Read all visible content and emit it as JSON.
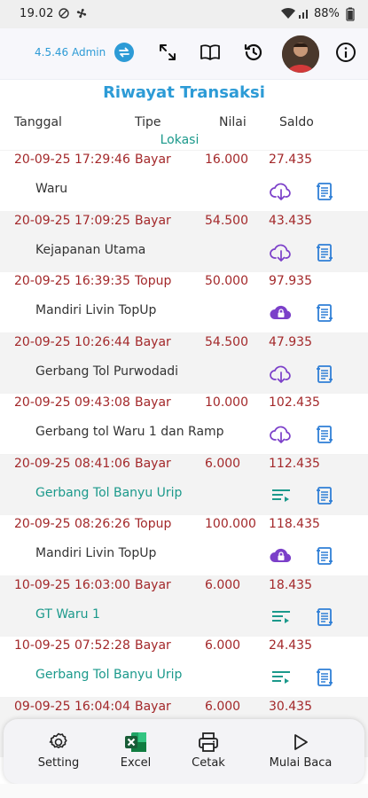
{
  "status_bar": {
    "time": "19.02",
    "battery": "88%"
  },
  "toolbar": {
    "version": "4.5.46 Admin"
  },
  "page": {
    "title": "Riwayat Transaksi",
    "columns": {
      "date": "Tanggal",
      "type": "Tipe",
      "value": "Nilai",
      "balance": "Saldo",
      "location": "Lokasi"
    }
  },
  "transactions": [
    {
      "date": "20-09-25 17:29:46",
      "type": "Bayar",
      "value": "16.000",
      "balance": "27.435",
      "location": "Waru",
      "loc_teal": false,
      "action_icon": "cloud-download-icon"
    },
    {
      "date": "20-09-25 17:09:25",
      "type": "Bayar",
      "value": "54.500",
      "balance": "43.435",
      "location": "Kejapanan Utama",
      "loc_teal": false,
      "action_icon": "cloud-download-icon"
    },
    {
      "date": "20-09-25 16:39:35",
      "type": "Topup",
      "value": "50.000",
      "balance": "97.935",
      "location": "Mandiri Livin TopUp",
      "loc_teal": false,
      "action_icon": "cloud-lock-icon"
    },
    {
      "date": "20-09-25 10:26:44",
      "type": "Bayar",
      "value": "54.500",
      "balance": "47.935",
      "location": "Gerbang Tol Purwodadi",
      "loc_teal": false,
      "action_icon": "cloud-download-icon"
    },
    {
      "date": "20-09-25 09:43:08",
      "type": "Bayar",
      "value": "10.000",
      "balance": "102.435",
      "location": "Gerbang tol Waru 1 dan Ramp",
      "loc_teal": false,
      "action_icon": "cloud-download-icon"
    },
    {
      "date": "20-09-25 08:41:06",
      "type": "Bayar",
      "value": "6.000",
      "balance": "112.435",
      "location": "Gerbang Tol Banyu Urip",
      "loc_teal": true,
      "action_icon": "list-edit-icon"
    },
    {
      "date": "20-09-25 08:26:26",
      "type": "Topup",
      "value": "100.000",
      "balance": "118.435",
      "location": "Mandiri Livin TopUp",
      "loc_teal": false,
      "action_icon": "cloud-lock-icon"
    },
    {
      "date": "10-09-25 16:03:00",
      "type": "Bayar",
      "value": "6.000",
      "balance": "18.435",
      "location": "GT Waru 1",
      "loc_teal": true,
      "action_icon": "list-edit-icon"
    },
    {
      "date": "10-09-25 07:52:28",
      "type": "Bayar",
      "value": "6.000",
      "balance": "24.435",
      "location": "Gerbang Tol Banyu Urip",
      "loc_teal": true,
      "action_icon": "list-edit-icon"
    },
    {
      "date": "09-09-25 16:04:04",
      "type": "Bayar",
      "value": "6.000",
      "balance": "30.435",
      "location": "",
      "loc_teal": false,
      "action_icon": ""
    }
  ],
  "bottom_bar": [
    {
      "label": "Setting",
      "icon": "gear-icon"
    },
    {
      "label": "Excel",
      "icon": "excel-icon"
    },
    {
      "label": "Cetak",
      "icon": "printer-icon"
    },
    {
      "label": "Mulai Baca",
      "icon": "play-icon"
    }
  ],
  "colors": {
    "accent": "#2d9bd6",
    "red": "#a3282a",
    "teal": "#1b998b",
    "purple": "#7b3fc9"
  }
}
